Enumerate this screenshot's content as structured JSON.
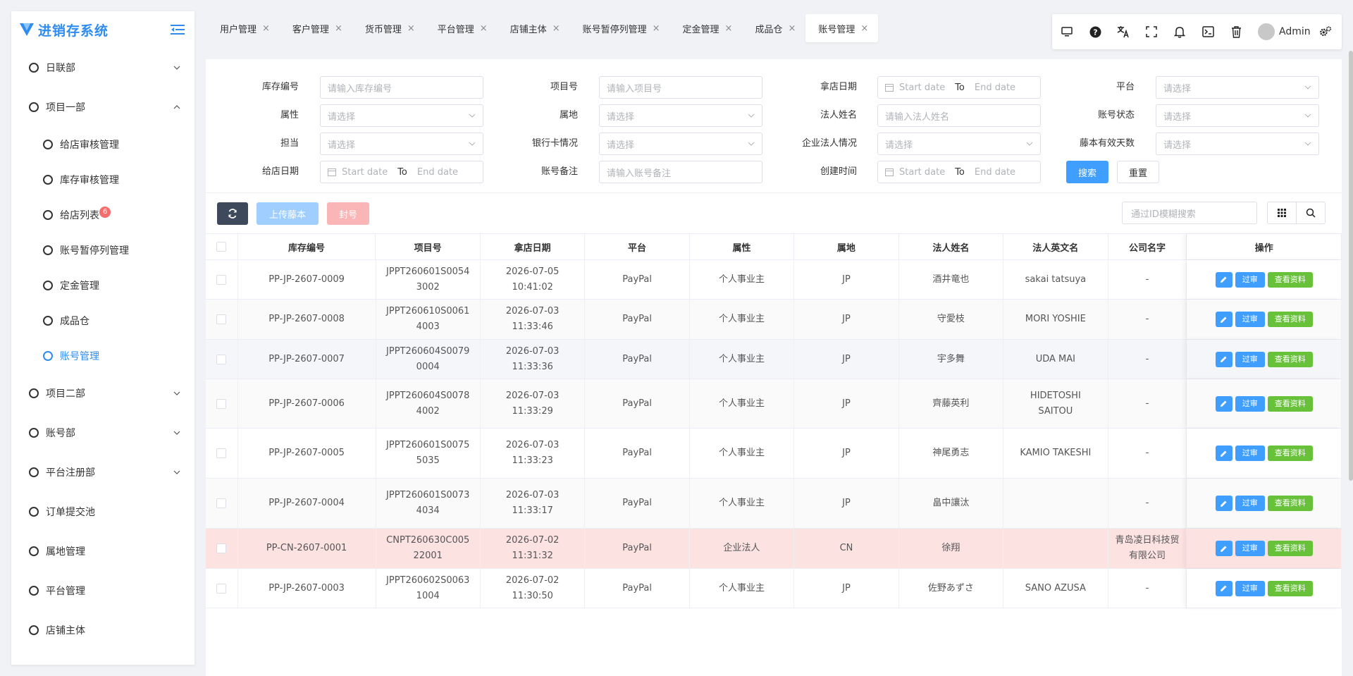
{
  "app": {
    "title": "进销存系统"
  },
  "sidebar": {
    "items": [
      {
        "label": "日联部",
        "expandable": true,
        "expanded": false
      },
      {
        "label": "项目一部",
        "expandable": true,
        "expanded": true
      },
      {
        "label": "项目二部",
        "expandable": true,
        "expanded": false
      },
      {
        "label": "账号部",
        "expandable": true,
        "expanded": false
      },
      {
        "label": "平台注册部",
        "expandable": true,
        "expanded": false
      },
      {
        "label": "订单提交池",
        "expandable": false
      },
      {
        "label": "属地管理",
        "expandable": false
      },
      {
        "label": "平台管理",
        "expandable": false
      },
      {
        "label": "店铺主体",
        "expandable": false
      }
    ],
    "sub_items": [
      {
        "label": "给店审核管理"
      },
      {
        "label": "库存审核管理"
      },
      {
        "label": "给店列表",
        "badge": "6"
      },
      {
        "label": "账号暂停列管理"
      },
      {
        "label": "定金管理"
      },
      {
        "label": "成品仓"
      },
      {
        "label": "账号管理",
        "active": true
      }
    ]
  },
  "tabs": [
    {
      "label": "用户管理"
    },
    {
      "label": "客户管理"
    },
    {
      "label": "货币管理"
    },
    {
      "label": "平台管理"
    },
    {
      "label": "店铺主体"
    },
    {
      "label": "账号暂停列管理"
    },
    {
      "label": "定金管理"
    },
    {
      "label": "成品仓"
    },
    {
      "label": "账号管理",
      "active": true
    }
  ],
  "topbar": {
    "icons": [
      "monitor-icon",
      "help-icon",
      "translate-icon",
      "fullscreen-icon",
      "bell-icon",
      "terminal-icon",
      "trash-icon"
    ],
    "user": "Admin"
  },
  "filters": {
    "stock_no_label": "库存编号",
    "stock_no_ph": "请输入库存编号",
    "project_no_label": "项目号",
    "project_no_ph": "请输入项目号",
    "take_date_label": "拿店日期",
    "platform_label": "平台",
    "platform_ph": "请选择",
    "attr_label": "属性",
    "attr_ph": "请选择",
    "region_label": "属地",
    "region_ph": "请选择",
    "legal_name_label": "法人姓名",
    "legal_name_ph": "请输入法人姓名",
    "acct_status_label": "账号状态",
    "acct_status_ph": "请选择",
    "owner_label": "担当",
    "owner_ph": "请选择",
    "bank_label": "银行卡情况",
    "bank_ph": "请选择",
    "corp_label": "企业法人情况",
    "corp_ph": "请选择",
    "vine_label": "藤本有效天数",
    "vine_ph": "请选择",
    "give_date_label": "给店日期",
    "acct_note_label": "账号备注",
    "acct_note_ph": "请输入账号备注",
    "created_label": "创建时间",
    "start_date": "Start date",
    "to": "To",
    "end_date": "End date",
    "search": "搜索",
    "reset": "重置"
  },
  "actions": {
    "upload": "上传藤本",
    "seal": "封号",
    "id_search_ph": "通过ID模糊搜索"
  },
  "table": {
    "headers": [
      "库存编号",
      "项目号",
      "拿店日期",
      "平台",
      "属性",
      "属地",
      "法人姓名",
      "法人英文名",
      "公司名字",
      "操作"
    ],
    "op_labels": {
      "audit": "过审",
      "view": "查看资料"
    },
    "rows": [
      {
        "stock": "PP-JP-2607-0009",
        "project": "JPPT260601S0054\n3002",
        "date": "2026-07-05\n10:41:02",
        "platform": "PayPal",
        "attr": "个人事业主",
        "region": "JP",
        "legal": "酒井竜也",
        "legal_en": "sakai tatsuya",
        "company": "-",
        "height": 56,
        "bg": "#ffffff"
      },
      {
        "stock": "PP-JP-2607-0008",
        "project": "JPPT260610S0061\n4003",
        "date": "2026-07-03\n11:33:46",
        "platform": "PayPal",
        "attr": "个人事业主",
        "region": "JP",
        "legal": "守愛枝",
        "legal_en": "MORI YOSHIE",
        "company": "-",
        "height": 57,
        "bg": "#fafafa"
      },
      {
        "stock": "PP-JP-2607-0007",
        "project": "JPPT260604S0079\n0004",
        "date": "2026-07-03\n11:33:36",
        "platform": "PayPal",
        "attr": "个人事业主",
        "region": "JP",
        "legal": "宇多舞",
        "legal_en": "UDA MAI",
        "company": "-",
        "height": 56,
        "bg": "#f4f6fa"
      },
      {
        "stock": "PP-JP-2607-0006",
        "project": "JPPT260604S0078\n4002",
        "date": "2026-07-03\n11:33:29",
        "platform": "PayPal",
        "attr": "个人事业主",
        "region": "JP",
        "legal": "齊藤英利",
        "legal_en": "HIDETOSHI\nSAITOU",
        "company": "-",
        "height": 70,
        "bg": "#fafafa"
      },
      {
        "stock": "PP-JP-2607-0005",
        "project": "JPPT260601S0075\n5035",
        "date": "2026-07-03\n11:33:23",
        "platform": "PayPal",
        "attr": "个人事业主",
        "region": "JP",
        "legal": "神尾勇志",
        "legal_en": "KAMIO TAKESHI",
        "company": "-",
        "height": 71,
        "bg": "#ffffff"
      },
      {
        "stock": "PP-JP-2607-0004",
        "project": "JPPT260601S0073\n4034",
        "date": "2026-07-03\n11:33:17",
        "platform": "PayPal",
        "attr": "个人事业主",
        "region": "JP",
        "legal": "畠中讓汰",
        "legal_en": "",
        "company": "-",
        "height": 71,
        "bg": "#fafafa"
      },
      {
        "stock": "PP-CN-2607-0001",
        "project": "CNPT260630C005\n22001",
        "date": "2026-07-02\n11:31:32",
        "platform": "PayPal",
        "attr": "企业法人",
        "region": "CN",
        "legal": "徐翔",
        "legal_en": "",
        "company": "青岛凌日科技贸\n有限公司",
        "height": 57,
        "bg": "#fde2e2"
      },
      {
        "stock": "PP-JP-2607-0003",
        "project": "JPPT260602S0063\n1004",
        "date": "2026-07-02\n11:30:50",
        "platform": "PayPal",
        "attr": "个人事业主",
        "region": "JP",
        "legal": "佐野あずさ",
        "legal_en": "SANO AZUSA",
        "company": "-",
        "height": 56,
        "bg": "#ffffff"
      }
    ]
  }
}
